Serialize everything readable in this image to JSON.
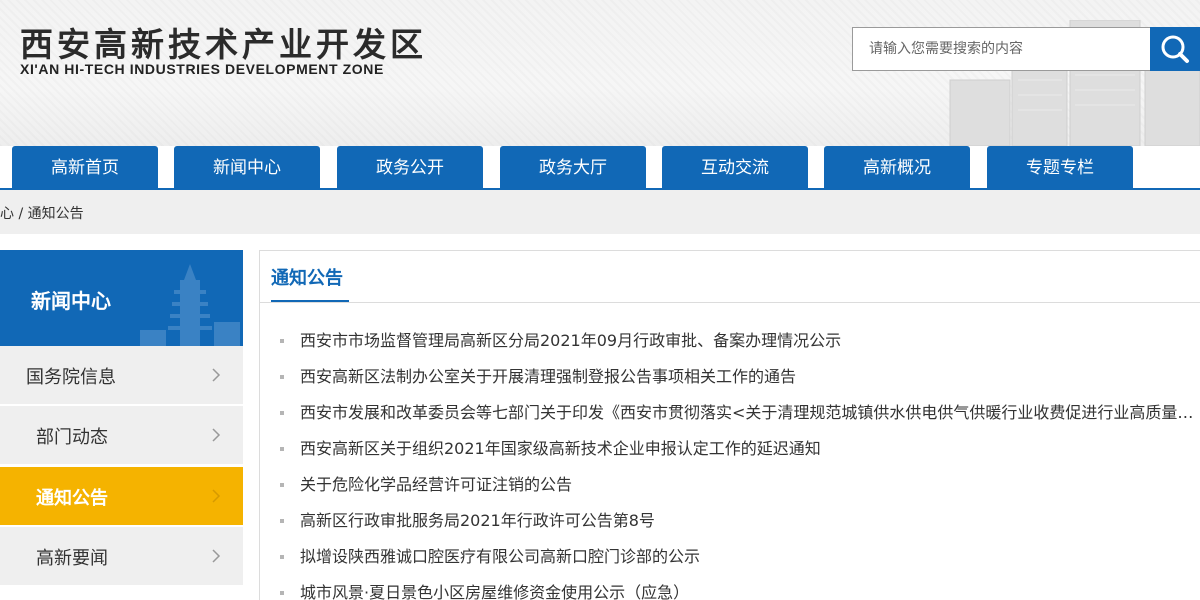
{
  "header": {
    "logo_cn": "西安高新技术产业开发区",
    "logo_en": "XI'AN HI-TECH INDUSTRIES DEVELOPMENT ZONE",
    "search_placeholder": "请输入您需要搜索的内容",
    "search_icon": "search-icon"
  },
  "nav": {
    "items": [
      "高新首页",
      "新闻中心",
      "政务公开",
      "政务大厅",
      "互动交流",
      "高新概况",
      "专题专栏"
    ]
  },
  "breadcrumb": {
    "text": "心 / 通知公告"
  },
  "sidebar": {
    "title": "新闻中心",
    "items": [
      {
        "label": "国务院信息",
        "active": false
      },
      {
        "label": "部门动态",
        "active": false
      },
      {
        "label": "通知公告",
        "active": true
      },
      {
        "label": "高新要闻",
        "active": false
      }
    ]
  },
  "content": {
    "title": "通知公告",
    "items": [
      "西安市市场监督管理局高新区分局2021年09月行政审批、备案办理情况公示",
      "西安高新区法制办公室关于开展清理强制登报公告事项相关工作的通告",
      "西安市发展和改革委员会等七部门关于印发《西安市贯彻落实<关于清理规范城镇供水供电供气供暖行业收费促进行业高质量发展的意见>实施方案》的通知",
      "西安高新区关于组织2021年国家级高新技术企业申报认定工作的延迟通知",
      "关于危险化学品经营许可证注销的公告",
      "高新区行政审批服务局2021年行政许可公告第8号",
      "拟增设陕西雅诚口腔医疗有限公司高新口腔门诊部的公示",
      "城市风景·夏日景色小区房屋维修资金使用公示（应急）"
    ]
  },
  "colors": {
    "primary": "#1168b6",
    "active": "#f5b300",
    "sidebar_bg": "#efefef"
  }
}
